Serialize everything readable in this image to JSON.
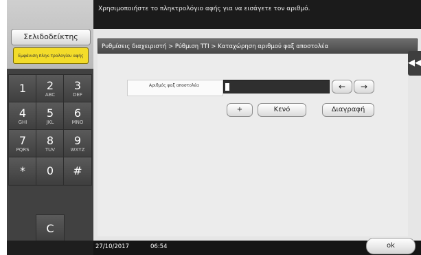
{
  "header": {
    "message": "Χρησιμοποιήστε το πληκτρολόγιο αφής για να εισάγετε τον αριθμό."
  },
  "sidebar": {
    "bookmark_label": "Σελιδοδείκτης",
    "touch_keypad_label": "Εμφάνιση πληκ-τρολογίου αφής",
    "keys": [
      {
        "digit": "1",
        "letters": ""
      },
      {
        "digit": "2",
        "letters": "ABC"
      },
      {
        "digit": "3",
        "letters": "DEF"
      },
      {
        "digit": "4",
        "letters": "GHI"
      },
      {
        "digit": "5",
        "letters": "JKL"
      },
      {
        "digit": "6",
        "letters": "MNO"
      },
      {
        "digit": "7",
        "letters": "PQRS"
      },
      {
        "digit": "8",
        "letters": "TUV"
      },
      {
        "digit": "9",
        "letters": "WXYZ"
      },
      {
        "digit": "*",
        "letters": ""
      },
      {
        "digit": "0",
        "letters": ""
      },
      {
        "digit": "#",
        "letters": ""
      },
      {
        "digit": "C",
        "letters": ""
      }
    ]
  },
  "main": {
    "breadcrumb": "Ρυθμίσεις διαχειριστή > Ρύθμιση TTI > Καταχώρηση αριθμού φαξ αποστολέα",
    "collapse_icon": "double-left-arrow-icon",
    "field_label": "Αριθμός φαξ αποστολέα",
    "field_value": "",
    "left_arrow": "←",
    "right_arrow": "→",
    "plus_label": "+",
    "space_label": "Κενό",
    "delete_label": "Διαγραφή"
  },
  "status": {
    "date": "27/10/2017",
    "time": "06:54"
  },
  "footer": {
    "ok_label": "ok"
  },
  "colors": {
    "accent_yellow": "#f3dc2a",
    "dark_bar": "#1b1b1b"
  }
}
